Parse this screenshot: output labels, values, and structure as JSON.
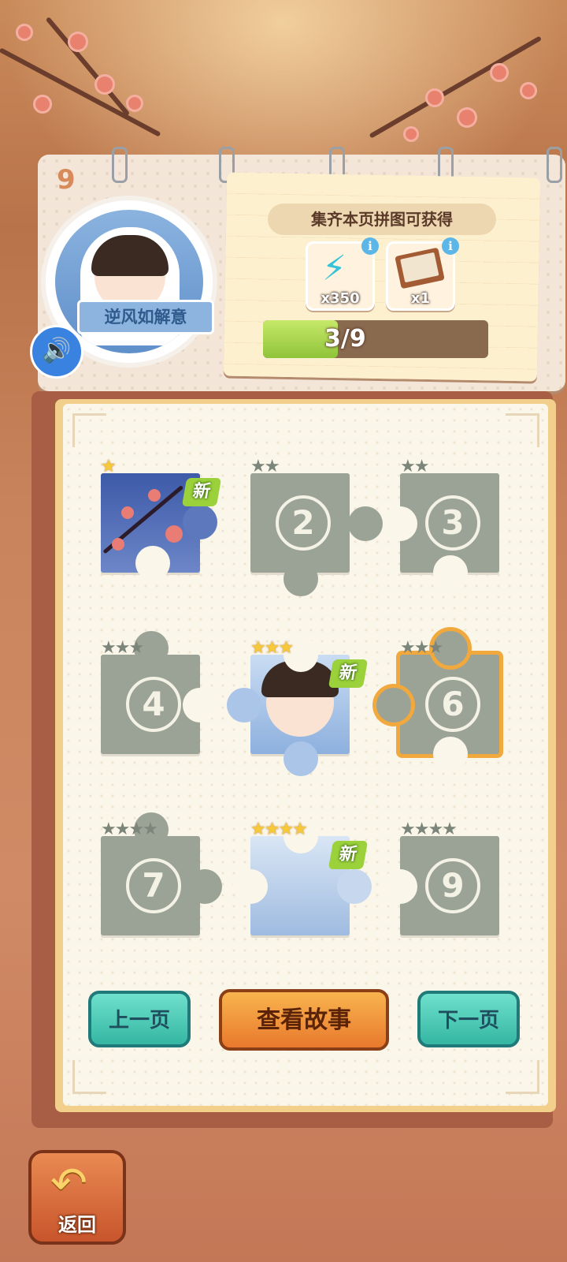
{
  "header": {
    "page_number": "9",
    "character_name": "逆风如解意",
    "speaker_icon": "speaker-icon"
  },
  "reward": {
    "title": "集齐本页拼图可获得",
    "items": [
      {
        "icon": "lightning-icon",
        "qty": "x350"
      },
      {
        "icon": "book-pen-icon",
        "qty": "x1"
      }
    ],
    "progress": {
      "collected": 3,
      "total": 9,
      "text": "3/9"
    }
  },
  "pieces": [
    {
      "id": 1,
      "label": "",
      "collected": true,
      "is_new": true,
      "new_label": "新",
      "stars": 1,
      "max_stars": 1
    },
    {
      "id": 2,
      "label": "2",
      "collected": false,
      "is_new": false,
      "stars": 0,
      "max_stars": 2
    },
    {
      "id": 3,
      "label": "3",
      "collected": false,
      "is_new": false,
      "stars": 0,
      "max_stars": 2
    },
    {
      "id": 4,
      "label": "4",
      "collected": false,
      "is_new": false,
      "stars": 0,
      "max_stars": 3
    },
    {
      "id": 5,
      "label": "",
      "collected": true,
      "is_new": true,
      "new_label": "新",
      "stars": 3,
      "max_stars": 3
    },
    {
      "id": 6,
      "label": "6",
      "collected": false,
      "is_new": false,
      "stars": 0,
      "max_stars": 3,
      "selected": true
    },
    {
      "id": 7,
      "label": "7",
      "collected": false,
      "is_new": false,
      "stars": 0,
      "max_stars": 4
    },
    {
      "id": 8,
      "label": "",
      "collected": true,
      "is_new": true,
      "new_label": "新",
      "stars": 4,
      "max_stars": 4
    },
    {
      "id": 9,
      "label": "9",
      "collected": false,
      "is_new": false,
      "stars": 0,
      "max_stars": 4
    }
  ],
  "buttons": {
    "prev": "上一页",
    "story": "查看故事",
    "next": "下一页",
    "back": "返回"
  },
  "colors": {
    "accent_orange": "#e9792d",
    "accent_teal": "#34b7a3",
    "progress_green": "#8fc43a",
    "locked_piece": "#9aa396",
    "star_gold": "#f6c83a"
  }
}
